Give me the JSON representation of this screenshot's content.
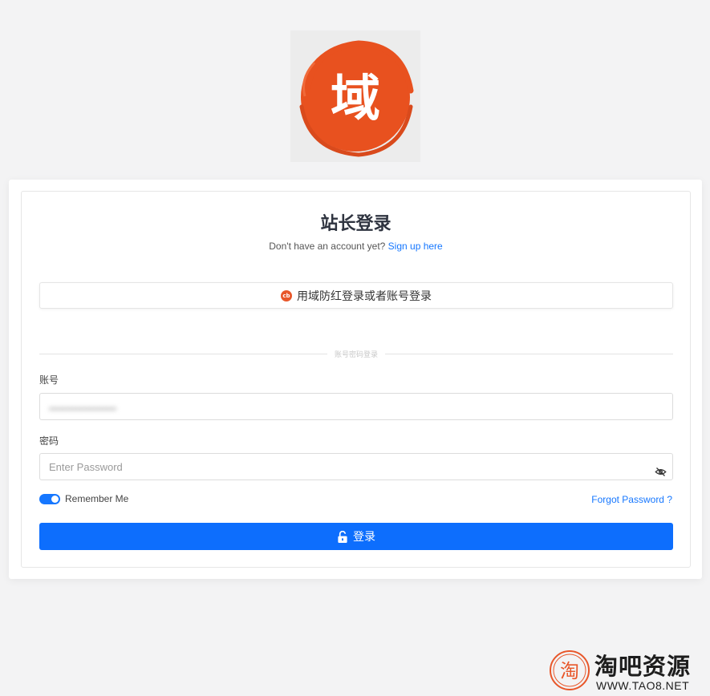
{
  "logo": {
    "text": "域",
    "icon": "brush-circle-logo",
    "color": "#e8511f"
  },
  "card": {
    "title": "站长登录",
    "subtitle_prefix": "Don't have an account yet?",
    "signup_link": "Sign up here"
  },
  "oauth": {
    "label": "用域防红登录或者账号登录",
    "icon_text": "cb",
    "icon": "brand-icon"
  },
  "divider": {
    "text": "账号密码登录"
  },
  "account": {
    "label": "账号",
    "value": "••••••••••••••••••••"
  },
  "password": {
    "label": "密码",
    "placeholder": "Enter Password",
    "icon": "eye-off-icon"
  },
  "remember": {
    "label": "Remember Me",
    "checked": true
  },
  "forgot": {
    "label": "Forgot Password ?"
  },
  "login": {
    "label": "登录",
    "icon": "unlock-icon"
  },
  "watermark": {
    "title": "淘吧资源",
    "url": "WWW.TAO8.NET",
    "glyph": "淘"
  },
  "colors": {
    "primary": "#0d6efd",
    "link": "#1677ff",
    "accent": "#e8572a"
  }
}
